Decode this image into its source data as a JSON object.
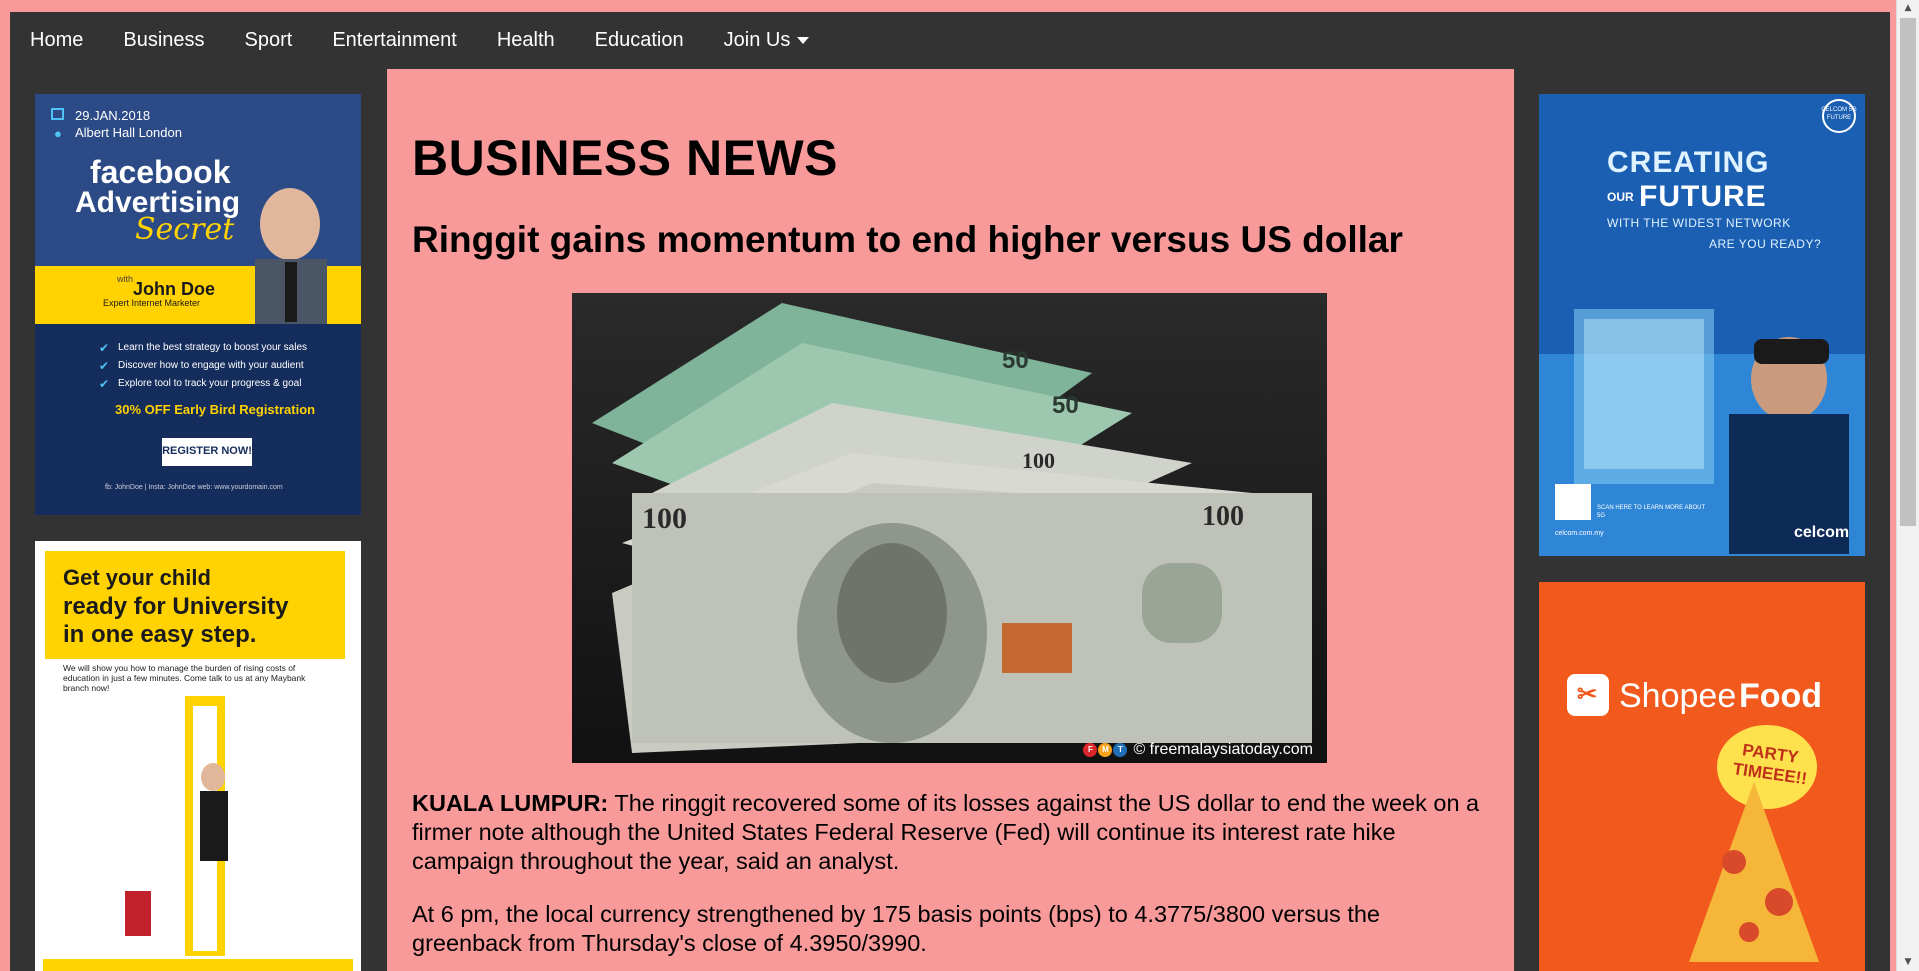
{
  "nav": {
    "items": [
      "Home",
      "Business",
      "Sport",
      "Entertainment",
      "Health",
      "Education"
    ],
    "join_label": "Join Us"
  },
  "main": {
    "section_title": "BUSINESS NEWS",
    "headline": "Ringgit gains momentum to end higher versus US dollar",
    "photo_credit": "© freemalaysiatoday.com",
    "photo_logo": [
      "F",
      "M",
      "T"
    ],
    "dateline": "KUALA LUMPUR:",
    "paragraph1": "The ringgit recovered some of its losses against the US dollar to end the week on a firmer note although the United States Federal Reserve (Fed) will continue its interest rate hike campaign throughout the year, said an analyst.",
    "paragraph2": "At 6 pm, the local currency strengthened by 175 basis points (bps) to 4.3775/3800 versus the greenback from Thursday's close of 4.3950/3990."
  },
  "ads": {
    "fb": {
      "date": "29.JAN.2018",
      "venue": "Albert Hall London",
      "title1": "facebook",
      "title2": "Advertising",
      "title3": "Secret",
      "with": "with",
      "name": "John Doe",
      "role": "Expert Internet Marketer",
      "bullets": [
        "Learn the best strategy to boost your sales",
        "Discover how to engage with your audient",
        "Explore tool to track your progress & goal"
      ],
      "offer": "30% OFF Early Bird Registration",
      "cta": "REGISTER NOW!",
      "footer": "fb: JohnDoe | Insta: JohnDoe web: www.yourdomain.com"
    },
    "maybank": {
      "line1": "Get your child",
      "line2": "ready for University",
      "line3": "in one easy step.",
      "body": "We will show you how to manage the burden of rising costs of education in just a few minutes. Come talk to us at any Maybank branch now!"
    },
    "celcom": {
      "badge": "CELCOM 5G FUTURE",
      "line1": "CREATING",
      "line2_small": "OUR",
      "line2": "FUTURE",
      "line3": "WITH THE WIDEST NETWORK",
      "line4": "ARE YOU READY?",
      "scan": "SCAN HERE TO LEARN MORE ABOUT 5G",
      "url": "celcom.com.my",
      "brand": "celcom"
    },
    "shopee": {
      "brand1": "Shopee",
      "brand2": "Food",
      "bubble": "PARTY TIMEEE!!"
    }
  }
}
